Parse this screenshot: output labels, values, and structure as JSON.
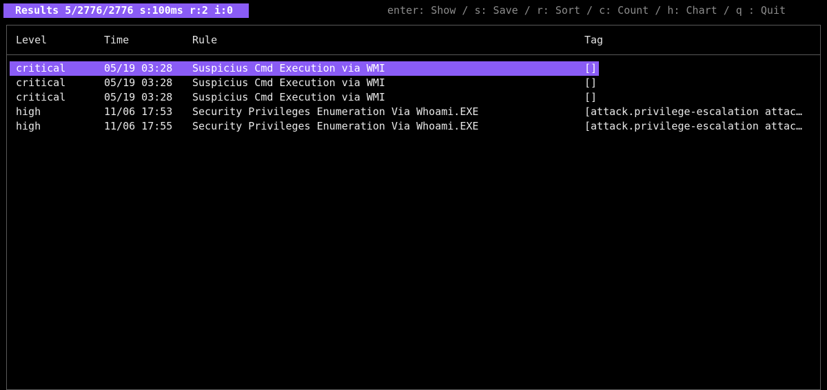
{
  "status": {
    "label": "Results 5/2776/2776 s:100ms r:2 i:0",
    "accent": "#8a5cf6"
  },
  "help": {
    "text": "enter: Show / s: Save / r: Sort / c: Count / h: Chart / q : Quit"
  },
  "table": {
    "headers": {
      "level": "Level",
      "time": "Time",
      "rule": "Rule",
      "tag": "Tag"
    },
    "rows": [
      {
        "level": "critical",
        "time": "05/19 03:28",
        "rule": "Suspicius Cmd Execution via WMI",
        "tag": "[]",
        "selected": true
      },
      {
        "level": "critical",
        "time": "05/19 03:28",
        "rule": "Suspicius Cmd Execution via WMI",
        "tag": "[]"
      },
      {
        "level": "critical",
        "time": "05/19 03:28",
        "rule": "Suspicius Cmd Execution via WMI",
        "tag": "[]"
      },
      {
        "level": "high",
        "time": "11/06 17:53",
        "rule": "Security Privileges Enumeration Via Whoami.EXE",
        "tag": "[attack.privilege-escalation attac…"
      },
      {
        "level": "high",
        "time": "11/06 17:55",
        "rule": "Security Privileges Enumeration Via Whoami.EXE",
        "tag": "[attack.privilege-escalation attac…"
      }
    ]
  }
}
